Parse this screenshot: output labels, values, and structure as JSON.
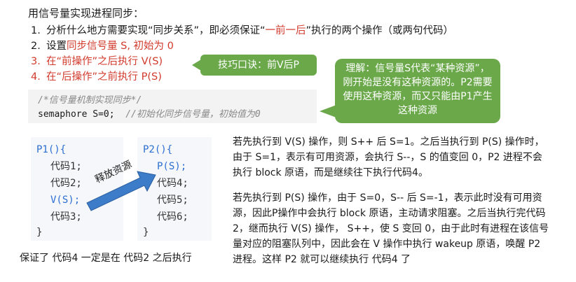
{
  "heading": "用信号量实现进程同步：",
  "steps": [
    {
      "num": "1.",
      "parts": [
        "分析什么地方需要实现“同步关系”，即必须保证“",
        "一前一后",
        "”执行的两个操作（或两句代码）"
      ]
    },
    {
      "num": "2.",
      "parts": [
        "设置",
        "同步信号量 S, 初始为 0"
      ]
    },
    {
      "num": "3.",
      "text": "在“前操作”之后执行 V(S)"
    },
    {
      "num": "4.",
      "text": "在“后操作”之前执行 P(S)"
    }
  ],
  "tip": "技巧口诀：前V后P",
  "bubble": "理解：信号量S代表“某种资源”，刚开始是没有这种资源的。P2需要使用这种资源，而又只能由P1产生这种资源",
  "code": {
    "comment1": "/*信号量机制实现同步*/",
    "decl": "semaphore S=0;",
    "comment2": "//初始化同步信号量，初始值为0"
  },
  "p1": {
    "header": "P1(){",
    "lines": [
      "代码1;",
      "代码2;",
      "V(S);",
      "代码3;"
    ],
    "close": "}"
  },
  "p2": {
    "header": "P2(){",
    "lines": [
      "P(S);",
      "代码4;",
      "代码5;",
      "代码6;"
    ],
    "close": "}"
  },
  "arrow_label": "释放资源",
  "para1": "若先执行到 V(S) 操作，则 S++ 后 S=1。之后当执行到 P(S) 操作时，由于 S=1，表示有可用资源，会执行 S--，S 的值变回 0，P2 进程不会执行 block 原语，而是继续往下执行代码4。",
  "para2": "若先执行到 P(S) 操作，由于 S=0，S-- 后 S=-1，表示此时没有可用资源，因此P操作中会执行 block 原语，主动请求阻塞。之后当执行完代码2，继而执行 V(S) 操作， S++，使 S 变回 0，由于此时有进程在该信号量对应的阻塞队列中，因此会在 V 操作中执行 wakeup 原语，唤醒 P2 进程。这样 P2 就可以继续执行 代码4 了",
  "caption": "保证了 代码4 一定是在 代码2 之后执行",
  "colors": {
    "accent_red": "#d23a2c",
    "bubble_green": "#6aa84a",
    "arrow_blue": "#3d7cc9",
    "code_blue": "#2c6fd0"
  }
}
